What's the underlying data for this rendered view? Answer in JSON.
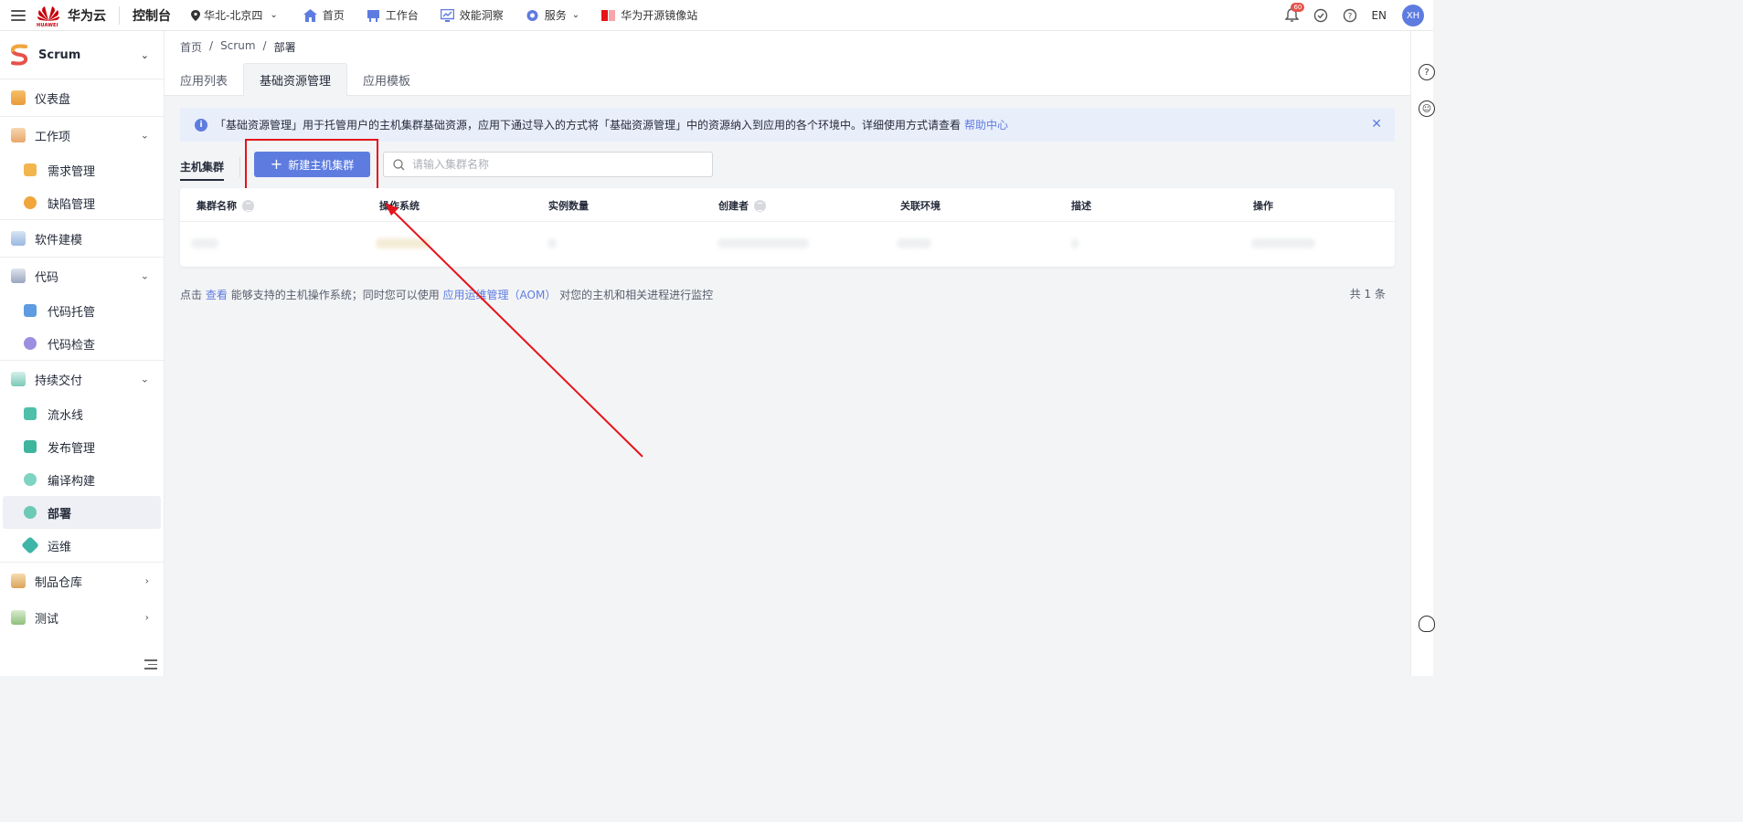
{
  "topbar": {
    "brand": "华为云",
    "brand_sub": "HUAWEI",
    "console": "控制台",
    "region": "华北-北京四",
    "nav": [
      {
        "label": "首页",
        "icon": "home-icon",
        "color": "#5e7ce0"
      },
      {
        "label": "工作台",
        "icon": "workbench-icon",
        "color": "#5e7ce0"
      },
      {
        "label": "效能洞察",
        "icon": "insight-icon",
        "color": "#5e7ce0"
      },
      {
        "label": "服务",
        "icon": "service-icon",
        "color": "#5e7ce0"
      },
      {
        "label": "华为开源镜像站",
        "icon": "mirror-icon",
        "color": "#e5131a"
      }
    ],
    "bell_badge": "60",
    "lang": "EN",
    "avatar": "XH"
  },
  "sidebar": {
    "project": "Scrum",
    "items": [
      {
        "label": "仪表盘",
        "level": 1
      },
      {
        "label": "工作项",
        "level": 1,
        "expanded": true
      },
      {
        "label": "需求管理",
        "level": 2
      },
      {
        "label": "缺陷管理",
        "level": 2
      },
      {
        "label": "软件建模",
        "level": 1
      },
      {
        "label": "代码",
        "level": 1,
        "expanded": true
      },
      {
        "label": "代码托管",
        "level": 2
      },
      {
        "label": "代码检查",
        "level": 2
      },
      {
        "label": "持续交付",
        "level": 1,
        "expanded": true
      },
      {
        "label": "流水线",
        "level": 2
      },
      {
        "label": "发布管理",
        "level": 2
      },
      {
        "label": "编译构建",
        "level": 2
      },
      {
        "label": "部署",
        "level": 2,
        "active": true
      },
      {
        "label": "运维",
        "level": 2
      },
      {
        "label": "制品仓库",
        "level": 1,
        "expanded": false
      },
      {
        "label": "测试",
        "level": 1,
        "expanded": false
      }
    ]
  },
  "breadcrumb": [
    "首页",
    "Scrum",
    "部署"
  ],
  "tabs": [
    {
      "label": "应用列表",
      "active": false
    },
    {
      "label": "基础资源管理",
      "active": true
    },
    {
      "label": "应用模板",
      "active": false
    }
  ],
  "info": {
    "text": "「基础资源管理」用于托管用户的主机集群基础资源，应用下通过导入的方式将「基础资源管理」中的资源纳入到应用的各个环境中。详细使用方式请查看",
    "link": "帮助中心"
  },
  "toolbar": {
    "seg_tab": "主机集群",
    "new_button": "新建主机集群",
    "search_placeholder": "请输入集群名称"
  },
  "table": {
    "columns": [
      "集群名称",
      "操作系统",
      "实例数量",
      "创建者",
      "关联环境",
      "描述",
      "操作"
    ]
  },
  "footer": {
    "prefix": "点击",
    "link1": "查看",
    "mid": "能够支持的主机操作系统；同时您可以使用",
    "link2": "应用运维管理（AOM）",
    "suffix": "对您的主机和相关进程进行监控",
    "total": "共 1 条"
  },
  "colors": {
    "accent": "#5e7ce0",
    "annotation": "#e5131a"
  }
}
